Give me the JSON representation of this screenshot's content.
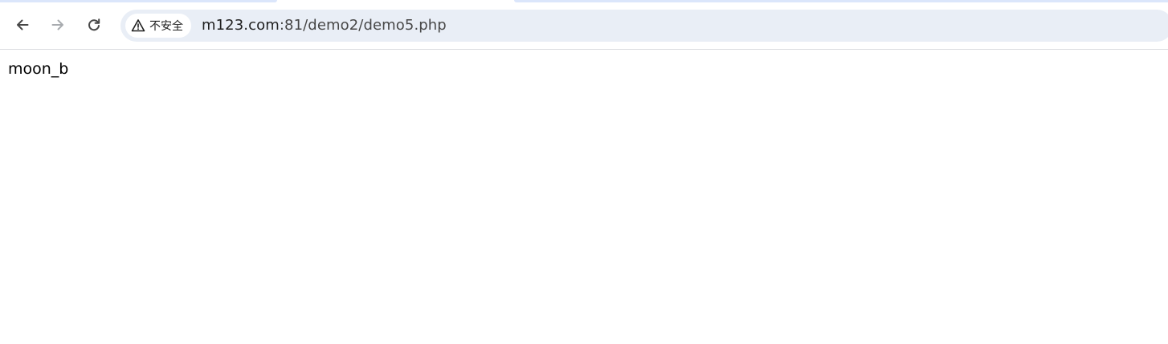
{
  "browser": {
    "nav": {
      "back_icon": "arrow-left-icon",
      "forward_icon": "arrow-right-icon",
      "reload_icon": "reload-icon"
    },
    "address_bar": {
      "security_icon": "warning-triangle-icon",
      "security_label": "不安全",
      "url_domain": "m123.com",
      "url_path": ":81/demo2/demo5.php"
    }
  },
  "page": {
    "body_text": "moon_b"
  },
  "colors": {
    "omnibox_bg": "#e9eef6",
    "tab_strip": "#dbe6fb",
    "icon_active": "#474747",
    "icon_disabled": "#a8abaf",
    "text": "#1f1f1f"
  }
}
